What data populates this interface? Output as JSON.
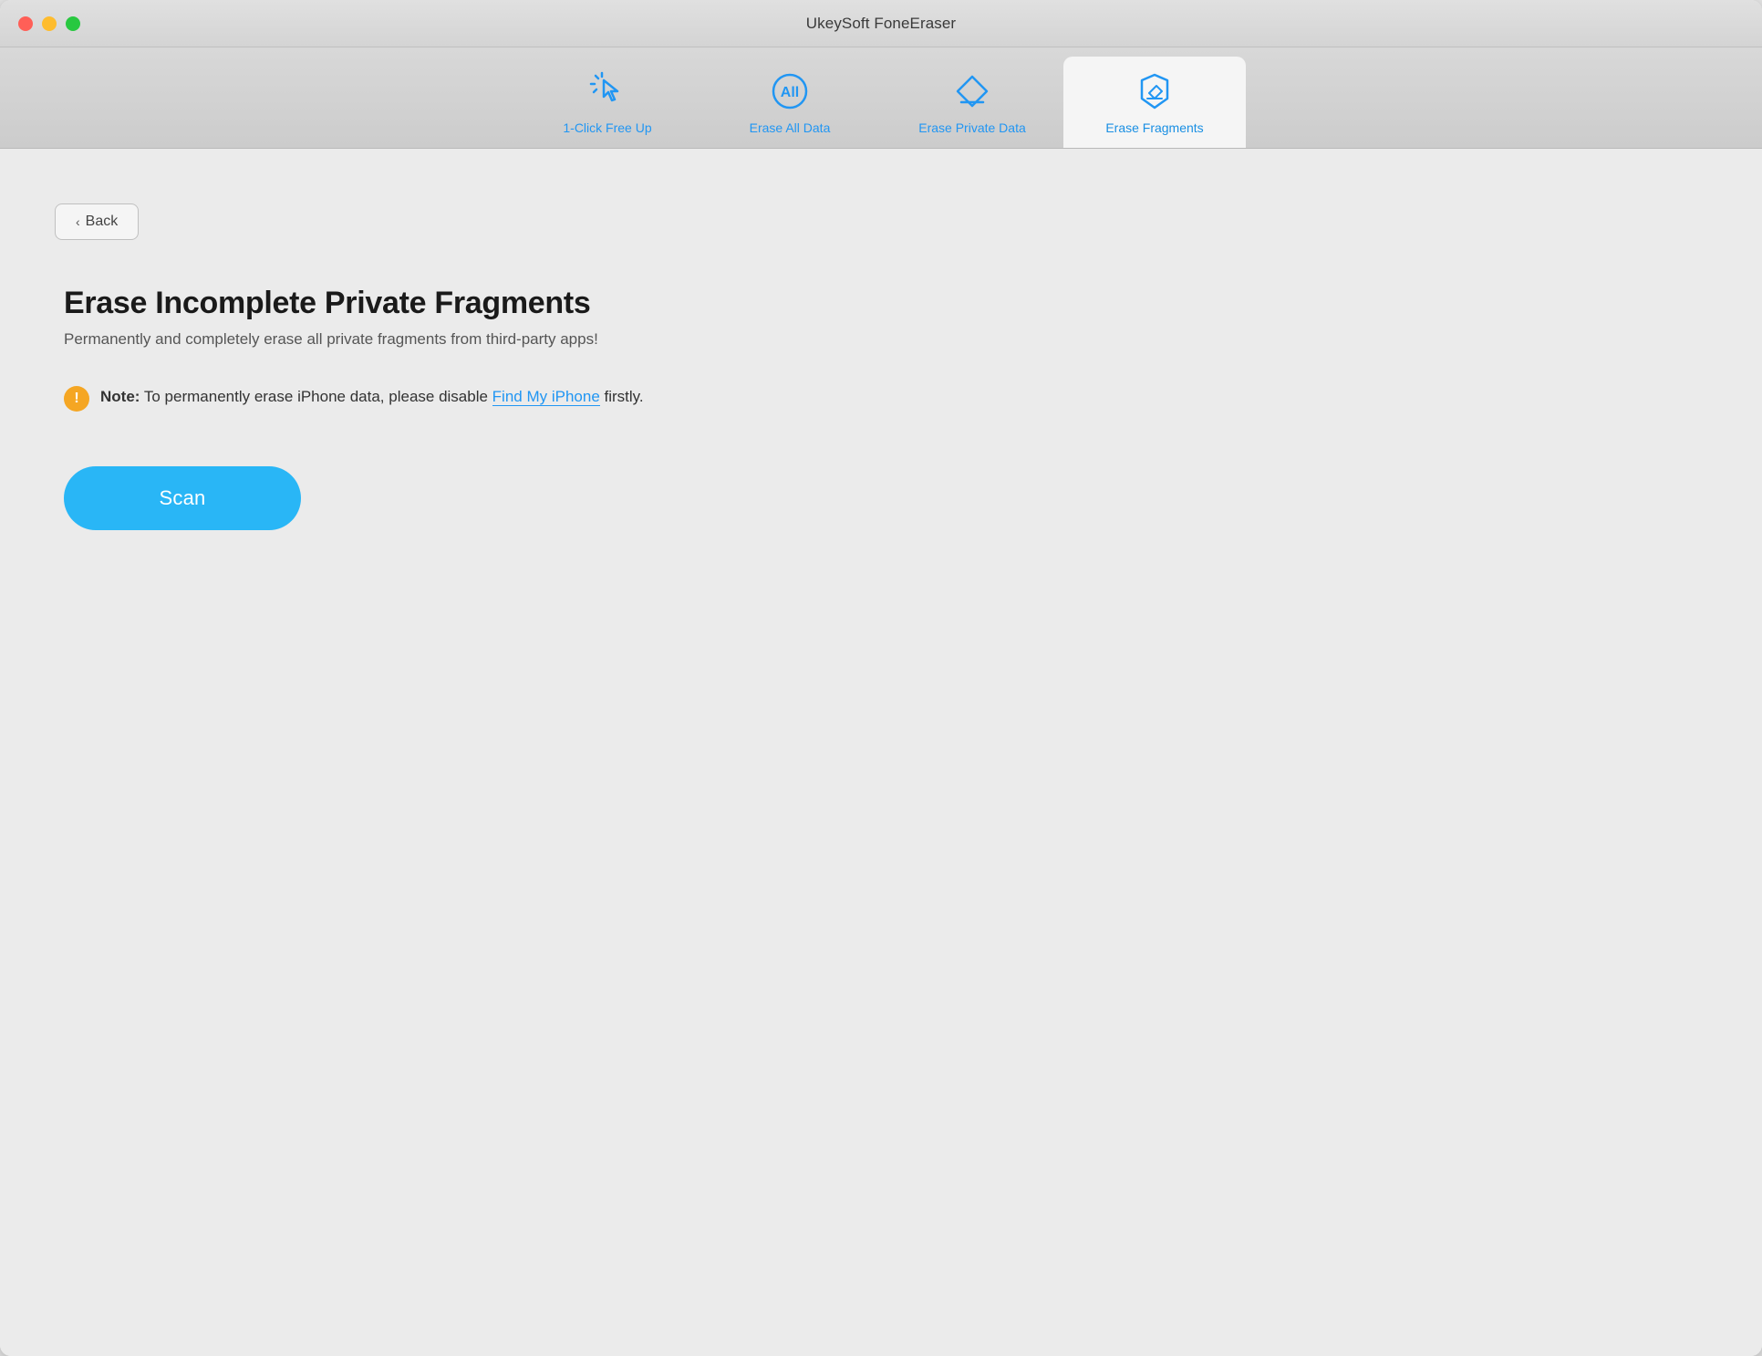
{
  "window": {
    "title": "UkeySoft FoneEraser"
  },
  "titlebar": {
    "buttons": {
      "close": "close",
      "minimize": "minimize",
      "maximize": "maximize"
    }
  },
  "tabs": [
    {
      "id": "one-click-free-up",
      "label": "1-Click Free Up",
      "active": false
    },
    {
      "id": "erase-all-data",
      "label": "Erase All Data",
      "active": false
    },
    {
      "id": "erase-private-data",
      "label": "Erase Private Data",
      "active": false
    },
    {
      "id": "erase-fragments",
      "label": "Erase Fragments",
      "active": true
    }
  ],
  "back_button": {
    "label": "Back"
  },
  "content": {
    "title": "Erase Incomplete Private Fragments",
    "subtitle": "Permanently and completely erase all private fragments from third-party apps!",
    "note_prefix": "Note:",
    "note_text": " To permanently erase iPhone data, please disable ",
    "note_link_text": "Find My iPhone",
    "note_suffix": " firstly.",
    "scan_button_label": "Scan"
  },
  "colors": {
    "blue": "#2196F3",
    "light_blue": "#29b6f6",
    "warning_orange": "#f5a623",
    "active_tab_bg": "#f5f5f5"
  }
}
